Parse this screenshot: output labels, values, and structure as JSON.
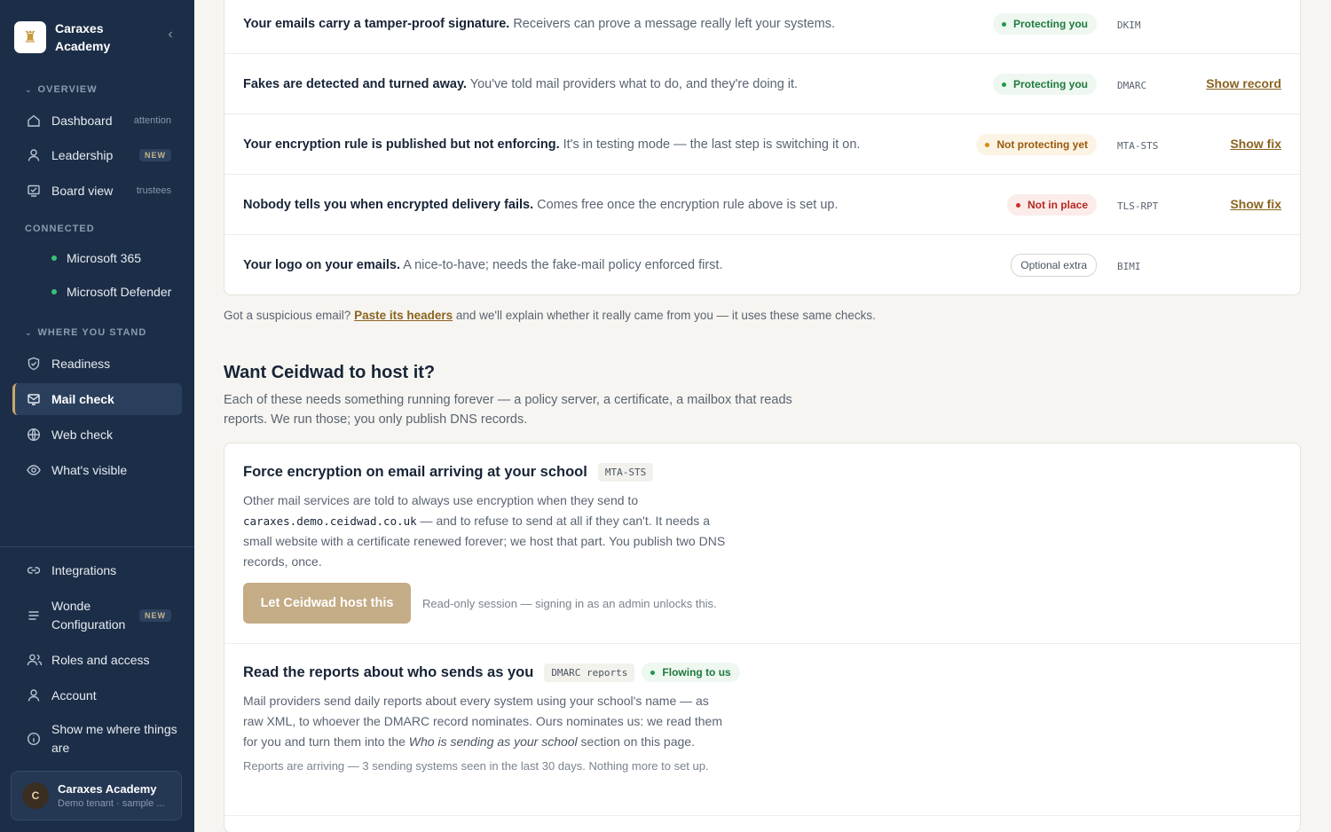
{
  "brand": {
    "line1": "Caraxes",
    "line2": "Academy",
    "collapse_icon": "chevron-left-icon"
  },
  "sidebar": {
    "overview_title": "OVERVIEW",
    "overview": [
      {
        "label": "Dashboard",
        "extra": "attention",
        "icon": "home-icon"
      },
      {
        "label": "Leadership",
        "badge": "NEW",
        "icon": "person-icon"
      },
      {
        "label": "Board view",
        "extra": "trustees",
        "icon": "board-icon"
      }
    ],
    "connected_title": "CONNECTED",
    "connected": [
      {
        "label": "Microsoft 365"
      },
      {
        "label": "Microsoft Defender"
      }
    ],
    "stand_title": "WHERE YOU STAND",
    "stand": [
      {
        "label": "Readiness",
        "icon": "shield-icon"
      },
      {
        "label": "Mail check",
        "icon": "mail-icon",
        "active": true
      },
      {
        "label": "Web check",
        "icon": "globe-icon"
      },
      {
        "label": "What's visible",
        "icon": "eye-icon"
      }
    ],
    "bottom": [
      {
        "label": "Integrations",
        "icon": "link-icon"
      },
      {
        "label_1": "Wonde",
        "label_2": "Configuration",
        "badge": "NEW",
        "icon": "lines-icon"
      },
      {
        "label": "Roles and access",
        "icon": "people-icon"
      },
      {
        "label": "Account",
        "icon": "person-icon"
      },
      {
        "label_1": "Show me where things",
        "label_2": "are",
        "icon": "info-icon"
      }
    ],
    "user": {
      "initial": "C",
      "name": "Caraxes Academy",
      "sub": "Demo tenant · sample ..."
    }
  },
  "checks": [
    {
      "bold": "Your emails carry a tamper-proof signature.",
      "rest": " Receivers can prove a message really left your systems.",
      "status": "Protecting you",
      "status_kind": "green",
      "code": "DKIM",
      "link": ""
    },
    {
      "bold": "Fakes are detected and turned away.",
      "rest": " You've told mail providers what to do, and they're doing it.",
      "status": "Protecting you",
      "status_kind": "green",
      "code": "DMARC",
      "link": "Show record"
    },
    {
      "bold": "Your encryption rule is published but not enforcing.",
      "rest": " It's in testing mode — the last step is switching it on.",
      "status": "Not protecting yet",
      "status_kind": "amber",
      "code": "MTA-STS",
      "link": "Show fix"
    },
    {
      "bold": "Nobody tells you when encrypted delivery fails.",
      "rest": " Comes free once the encryption rule above is set up.",
      "status": "Not in place",
      "status_kind": "red",
      "code": "TLS-RPT",
      "link": "Show fix"
    },
    {
      "bold": "Your logo on your emails.",
      "rest": " A nice-to-have; needs the fake-mail policy enforced first.",
      "status": "Optional extra",
      "status_kind": "opt",
      "code": "BIMI",
      "link": ""
    }
  ],
  "note": {
    "pre": "Got a suspicious email? ",
    "link": "Paste its headers",
    "post": " and we'll explain whether it really came from you — it uses these same checks."
  },
  "host": {
    "title": "Want Ceidwad to host it?",
    "lede": "Each of these needs something running forever — a policy server, a certificate, a mailbox that reads reports. We run those; you only publish DNS records.",
    "mta": {
      "title": "Force encryption on email arriving at your school",
      "chip": "MTA-STS",
      "body_1": "Other mail services are told to always use encryption when they send to ",
      "domain": "caraxes.demo.ceidwad.co.uk",
      "body_2": " — and to refuse to send at all if they can't. It needs a small website with a certificate renewed forever; we host that part. You publish two DNS records, once.",
      "button": "Let Ceidwad host this",
      "button_note": "Read-only session — signing in as an admin unlocks this."
    },
    "dmarc": {
      "title": "Read the reports about who sends as you",
      "chip": "DMARC reports",
      "status": "Flowing to us",
      "body_1": "Mail providers send daily reports about every system using your school's name — as raw XML, to whoever the DMARC record nominates. Ours nominates us: we read them for you and turn them into the ",
      "body_em": "Who is sending as your school",
      "body_2": " section on this page.",
      "foot": "Reports are arriving — 3 sending systems seen in the last 30 days. Nothing more to set up."
    }
  }
}
